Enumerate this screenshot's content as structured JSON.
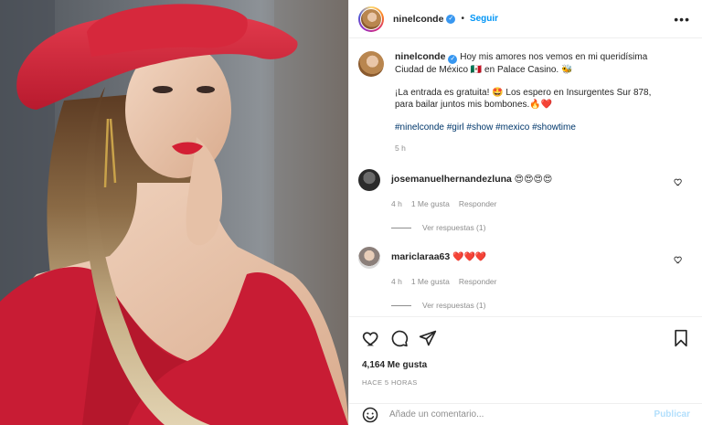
{
  "colors": {
    "accent": "#0095f6",
    "verified": "#3897f0",
    "hat_red": "#d6283c",
    "dress_red": "#c81c34",
    "link": "#00376b",
    "muted": "#8e8e8e",
    "publish_disabled": "#b2dffc"
  },
  "header": {
    "username": "ninelconde",
    "separator": "•",
    "follow_label": "Seguir",
    "more_label": "•••"
  },
  "caption": {
    "username": "ninelconde",
    "paragraph1": "Hoy mis amores nos vemos en mi queridísima Ciudad de México 🇲🇽 en Palace Casino. 🐝",
    "paragraph2": "¡La entrada es gratuita! 🤩 Los espero en Insurgentes Sur 878, para bailar juntos mis bombones.🔥❤️",
    "hashtags": [
      "#ninelconde",
      "#girl",
      "#show",
      "#mexico",
      "#showtime"
    ],
    "time": "5 h"
  },
  "comments": [
    {
      "username": "josemanuelhernandezluna",
      "text": "😍😍😍😍",
      "time": "4 h",
      "likes": "1 Me gusta",
      "reply_label": "Responder",
      "view_replies": "Ver respuestas (1)"
    },
    {
      "username": "mariclaraa63",
      "text": "❤️❤️❤️",
      "time": "4 h",
      "likes": "1 Me gusta",
      "reply_label": "Responder",
      "view_replies": "Ver respuestas (1)"
    }
  ],
  "actions": {
    "icons": [
      "heart-icon",
      "comment-icon",
      "share-icon",
      "bookmark-icon"
    ],
    "likes_count": "4,164 Me gusta",
    "posted_time": "HACE 5 HORAS"
  },
  "add_comment": {
    "emoji_icon": "smiley-icon",
    "placeholder": "Añade un comentario...",
    "publish_label": "Publicar"
  }
}
